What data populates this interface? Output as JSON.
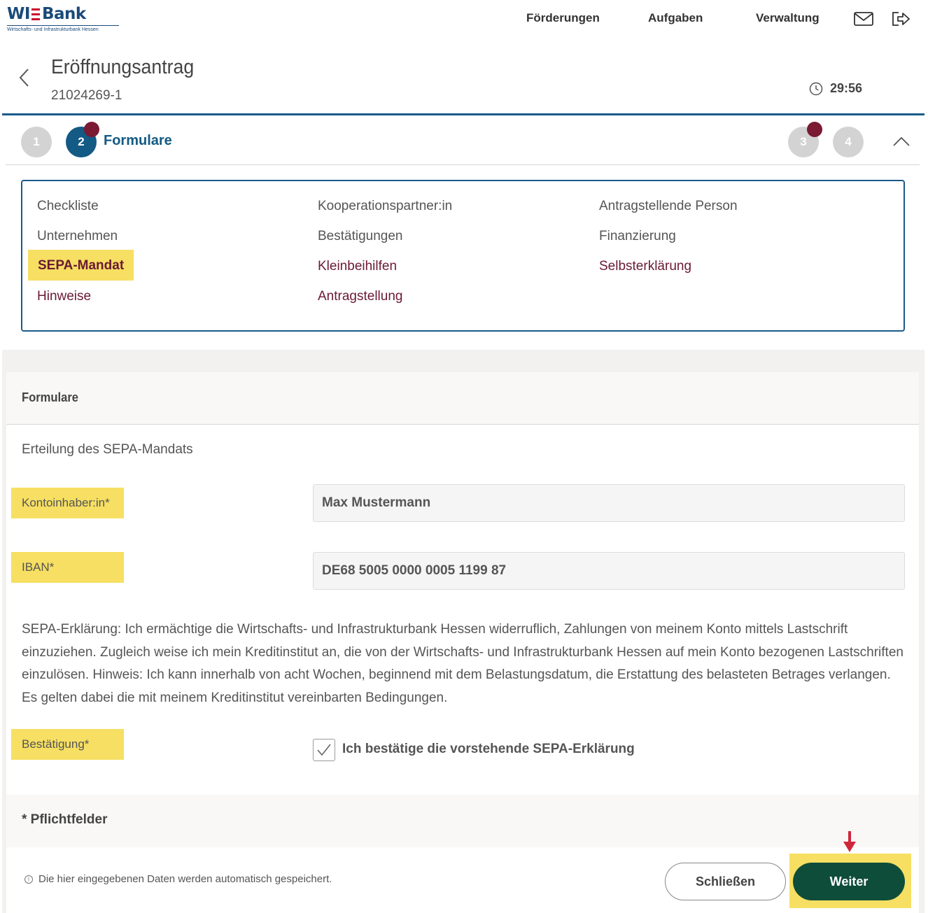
{
  "brand": {
    "logo_text_left": "WI",
    "logo_text_right": "Bank",
    "logo_subtitle": "Wirtschafts- und Infrastrukturbank Hessen",
    "bar_color": "#c8102e",
    "text_color": "#1a4a7a"
  },
  "topnav": {
    "items": [
      {
        "label": "Förderungen"
      },
      {
        "label": "Aufgaben"
      },
      {
        "label": "Verwaltung"
      }
    ],
    "icons": [
      "mail-icon",
      "logout-icon"
    ]
  },
  "page": {
    "title": "Eröffnungsantrag",
    "id": "21024269-1",
    "timer": "29:56"
  },
  "stepper": {
    "steps": [
      {
        "number": "1",
        "state": "inactive"
      },
      {
        "number": "2",
        "state": "active",
        "label": "Formulare",
        "badge": true
      },
      {
        "number": "3",
        "state": "inactive",
        "badge": true
      },
      {
        "number": "4",
        "state": "inactive"
      }
    ],
    "active_color": "#135a84",
    "badge_color": "#7a1a33"
  },
  "forms_nav": {
    "col1": [
      {
        "label": "Checkliste"
      },
      {
        "label": "Unternehmen"
      },
      {
        "label": "SEPA-Mandat"
      },
      {
        "label": "Hinweise"
      }
    ],
    "col2": [
      {
        "label": "Kooperationspartner:in"
      },
      {
        "label": "Bestätigungen"
      },
      {
        "label": "Kleinbeihilfen"
      },
      {
        "label": "Antragstellung"
      }
    ],
    "col3": [
      {
        "label": "Antragstellende Person"
      },
      {
        "label": "Finanzierung"
      },
      {
        "label": "Selbsterklärung"
      }
    ],
    "active_item": "SEPA-Mandat",
    "highlight_color": "#f6df62"
  },
  "form": {
    "section_title": "Formulare",
    "subtitle": "Erteilung des SEPA-Mandats",
    "account_holder": {
      "label": "Kontoinhaber:in*",
      "value": "Max Mustermann"
    },
    "iban": {
      "label": "IBAN*",
      "value": "DE68 5005 0000 0005 1199 87"
    },
    "sepa_text": "SEPA-Erklärung: Ich ermächtige die Wirtschafts- und Infrastrukturbank Hessen widerruflich, Zahlungen von meinem Konto mittels Lastschrift einzuziehen. Zugleich weise ich mein Kreditinstitut an, die von der Wirtschafts- und Infrastrukturbank Hessen auf mein Konto bezogenen Lastschriften einzulösen. Hinweis: Ich kann innerhalb von acht Wochen, beginnend mit dem Belastungsdatum, die Erstattung des belasteten Betrages verlangen. Es gelten dabei die mit meinem Kreditinstitut vereinbarten Bedingungen.",
    "confirmation": {
      "label": "Bestätigung*",
      "checkbox_label": "Ich bestätige die vorstehende SEPA-Erklärung",
      "checked": true
    },
    "required_note": "* Pflichtfelder"
  },
  "footer": {
    "autosave_note": "Die hier eingegebenen Daten werden automatisch gespeichert.",
    "close_label": "Schließen",
    "next_label": "Weiter",
    "next_color": "#0e4d3a",
    "arrow_color": "#d0263a"
  }
}
